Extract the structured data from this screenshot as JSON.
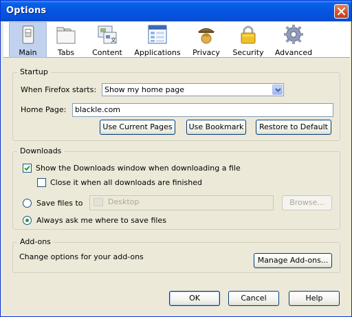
{
  "window": {
    "title": "Options"
  },
  "panes": [
    {
      "label": "Main",
      "icon": "switch-icon"
    },
    {
      "label": "Tabs",
      "icon": "tabs-icon"
    },
    {
      "label": "Content",
      "icon": "content-icon"
    },
    {
      "label": "Applications",
      "icon": "applications-icon"
    },
    {
      "label": "Privacy",
      "icon": "privacy-icon"
    },
    {
      "label": "Security",
      "icon": "lock-icon"
    },
    {
      "label": "Advanced",
      "icon": "gear-icon"
    }
  ],
  "startup": {
    "caption": "Startup",
    "when_starts_label": "When Firefox starts:",
    "when_starts_value": "Show my home page",
    "home_page_label": "Home Page:",
    "home_page_value": "blackle.com",
    "use_current_pages": "Use Current Pages",
    "use_bookmark": "Use Bookmark",
    "restore_default": "Restore to Default"
  },
  "downloads": {
    "caption": "Downloads",
    "show_window_label": "Show the Downloads window when downloading a file",
    "close_it_label": "Close it when all downloads are finished",
    "save_files_label": "Save files to",
    "save_folder_value": "Desktop",
    "browse_label": "Browse...",
    "always_ask_label": "Always ask me where to save files"
  },
  "addons": {
    "caption": "Add-ons",
    "description": "Change options for your add-ons",
    "manage_label": "Manage Add-ons..."
  },
  "footer": {
    "ok_label": "OK",
    "cancel_label": "Cancel",
    "help_label": "Help"
  },
  "colors": {
    "title_bar": "#0554e3",
    "dialog_bg": "#ece9d8",
    "active_pane": "#c1d2ee",
    "checkmark": "#21a121"
  }
}
